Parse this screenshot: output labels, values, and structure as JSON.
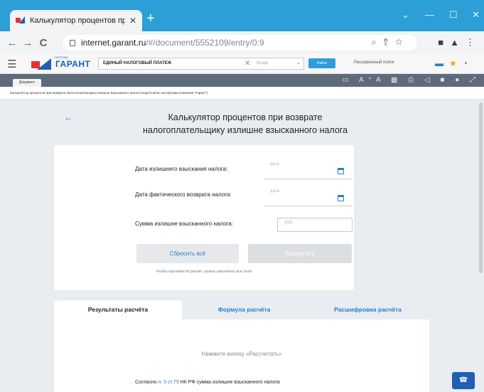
{
  "browser": {
    "tab_title": "Калькулятор процентов при во",
    "tab_close": "✕",
    "new_tab": "+",
    "window_controls": [
      "⌄",
      "—",
      "☐",
      "✕"
    ],
    "url_host": "internet.garant.ru",
    "url_path": "/#/document/5552109/entry/0:9",
    "nav": [
      "←",
      "→",
      "C"
    ]
  },
  "garant_header": {
    "menu_icon": "☰",
    "logo_small": "СИСТЕМА",
    "logo_text": "ГАРАНТ",
    "search_value": "ЕДИНЫЙ НАЛОГОВЫЙ ПЛАТЕЖ",
    "search_clear": "✕",
    "search_scope": "Везде",
    "find_button": "Найти",
    "advanced_search": "Расширенный поиск"
  },
  "doc_toolbar": {
    "tab_label": "Документ",
    "breadcrumb": "Калькулятор процентов при возврате налогоплательщику излишне взысканного налога (подготовлен экспертами компании \"Гарант\")"
  },
  "calculator": {
    "title_line1": "Калькулятор процентов при возврате",
    "title_line2": "налогоплательщику излишне взысканного налога",
    "fields": [
      {
        "label": "Дата излишнего взыскания налога:",
        "placeholder": "дата"
      },
      {
        "label": "Дата фактического возврата налога:",
        "placeholder": "дата"
      },
      {
        "label": "Сумма излишне взысканного налога:",
        "placeholder": "руб."
      }
    ],
    "reset_button": "Сбросить всё",
    "calc_button": "Рассчитать",
    "hint": "Чтобы произвести расчёт, нужно заполнить все поля"
  },
  "results": {
    "tabs": [
      "Результаты расчёта",
      "Формула расчёта",
      "Расшифровка расчёта"
    ],
    "press_prompt": "Нажмите кнопку «Рассчитать»",
    "accord_prefix": "Согласно ",
    "accord_link": "п. 5 ст.79",
    "accord_suffix": " НК РФ сумма излишне взысканного налога"
  },
  "colors": {
    "accent": "#2a7dc4",
    "browser_frame": "#2b9fd6",
    "page_bg": "#e9edf1"
  }
}
